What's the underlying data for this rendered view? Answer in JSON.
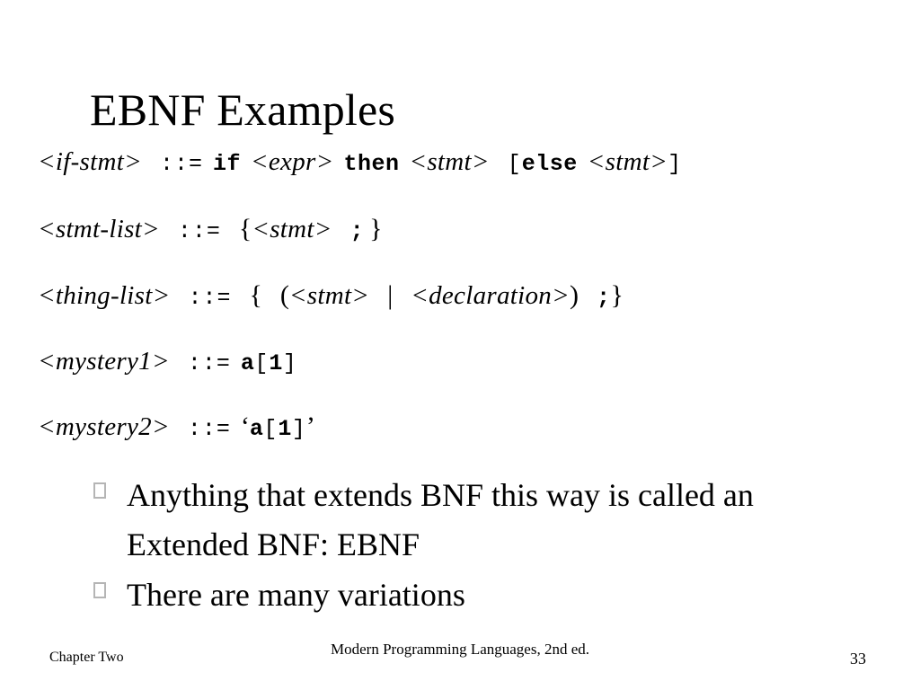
{
  "slide": {
    "title": "EBNF Examples",
    "page_number": "33",
    "background_color": "#ffffff",
    "text_color": "#000000",
    "bullet_marker_color": "#b5b5b5"
  },
  "grammar_rules": [
    {
      "lhs": "<if-stmt>",
      "operator": "::=",
      "rhs_plain": "if <expr> then <stmt> [else <stmt>]",
      "tokens": {
        "kw_if": "if",
        "nt_expr": "<expr>",
        "kw_then": "then",
        "nt_stmt_1": "<stmt>",
        "bracket_open": "[",
        "kw_else": "else",
        "nt_stmt_2": "<stmt>",
        "bracket_close": "]"
      }
    },
    {
      "lhs": "<stmt-list>",
      "operator": "::=",
      "rhs_plain": "{<stmt> ; }",
      "tokens": {
        "brace_open": "{",
        "nt_stmt": "<stmt>",
        "semicolon": ";",
        "brace_close": "}"
      }
    },
    {
      "lhs": "<thing-list>",
      "operator": "::=",
      "rhs_plain": "{ (<stmt> | <declaration>) ; }",
      "tokens": {
        "brace_open": "{",
        "paren_open": "(",
        "nt_stmt": "<stmt>",
        "pipe": "|",
        "nt_declaration": "<declaration>",
        "paren_close": ")",
        "semicolon": ";",
        "brace_close": "}"
      }
    },
    {
      "lhs": "<mystery1>",
      "operator": "::=",
      "rhs_plain": "a[1]",
      "tokens": {
        "term_a": "a",
        "bracket_open": "[",
        "term_1": "1",
        "bracket_close": "]"
      }
    },
    {
      "lhs": "<mystery2>",
      "operator": "::=",
      "rhs_plain": "‘a[1]’",
      "tokens": {
        "quote_open": "‘",
        "term_a": "a",
        "bracket_open": "[",
        "term_1": "1",
        "bracket_close": "]",
        "quote_close": "’"
      }
    }
  ],
  "bullets": [
    {
      "text": "Anything that extends BNF this way is called an Extended BNF: EBNF"
    },
    {
      "text": "There are many variations"
    }
  ],
  "footer": {
    "left": "Chapter Two",
    "center": "Modern Programming Languages, 2nd ed.",
    "right": "33"
  }
}
